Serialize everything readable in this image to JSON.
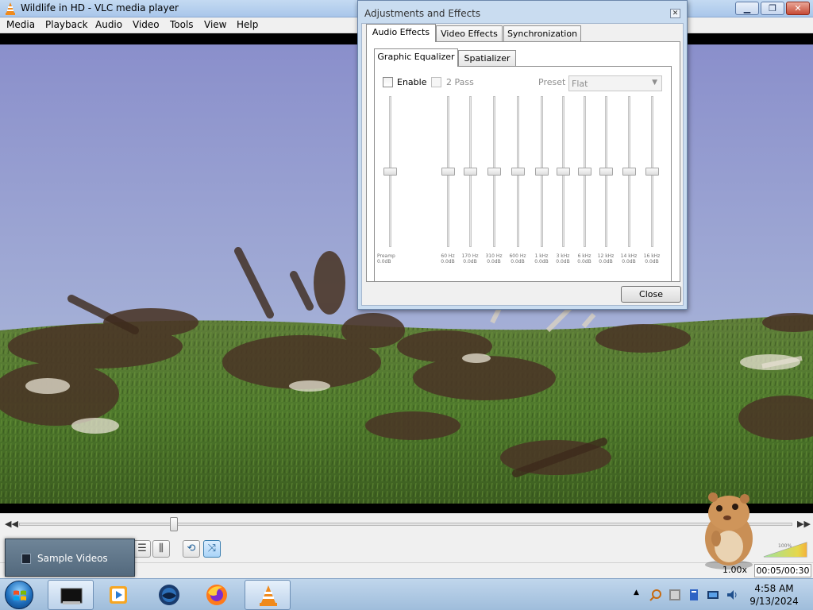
{
  "window": {
    "title": "Wildlife in HD - VLC media player"
  },
  "menu": [
    "Media",
    "Playback",
    "Audio",
    "Video",
    "Tools",
    "View",
    "Help"
  ],
  "playback": {
    "speed": "1.00x",
    "time": "00:05/00:30",
    "progress": 0.2,
    "volume_label": "100%"
  },
  "dialog": {
    "title": "Adjustments and Effects",
    "tabs": [
      "Audio Effects",
      "Video Effects",
      "Synchronization"
    ],
    "subtabs": [
      "Graphic Equalizer",
      "Spatializer"
    ],
    "enable_label": "Enable",
    "two_pass_label": "2 Pass",
    "preset_label": "Preset",
    "preset_value": "Flat",
    "preamp": {
      "name": "Preamp",
      "value": "0.0dB"
    },
    "bands": [
      {
        "name": "60 Hz",
        "value": "0.0dB"
      },
      {
        "name": "170 Hz",
        "value": "0.0dB"
      },
      {
        "name": "310 Hz",
        "value": "0.0dB"
      },
      {
        "name": "600 Hz",
        "value": "0.0dB"
      },
      {
        "name": "1 kHz",
        "value": "0.0dB"
      },
      {
        "name": "3 kHz",
        "value": "0.0dB"
      },
      {
        "name": "6 kHz",
        "value": "0.0dB"
      },
      {
        "name": "12 kHz",
        "value": "0.0dB"
      },
      {
        "name": "14 kHz",
        "value": "0.0dB"
      },
      {
        "name": "16 kHz",
        "value": "0.0dB"
      }
    ],
    "close_label": "Close"
  },
  "taskbar_popup": {
    "label": "Sample Videos"
  },
  "clock": {
    "time": "4:58 AM",
    "date": "9/13/2024"
  }
}
